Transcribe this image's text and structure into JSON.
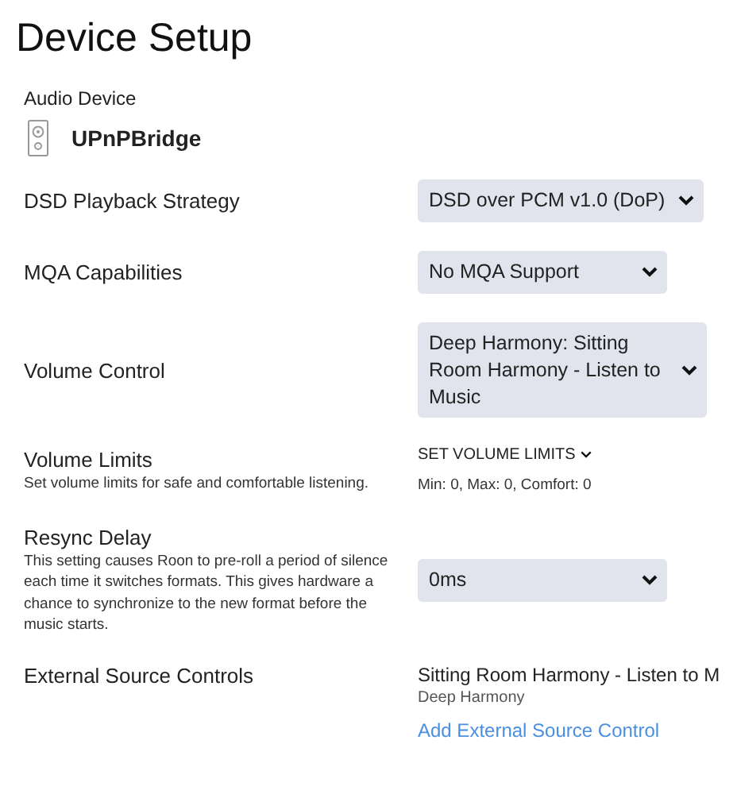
{
  "title": "Device Setup",
  "device": {
    "label": "Audio Device",
    "name": "UPnPBridge"
  },
  "settings": [
    {
      "kind": "select",
      "label": "DSD Playback Strategy",
      "value": "DSD over PCM v1.0 (DoP)"
    },
    {
      "kind": "select",
      "label": "MQA Capabilities",
      "value": "No MQA Support"
    },
    {
      "kind": "select",
      "label": "Volume Control",
      "value": "Deep Harmony: Sitting Room Harmony - Listen to Music"
    },
    {
      "kind": "limits",
      "label": "Volume Limits",
      "description": "Set volume limits for safe and comfortable listening.",
      "action": "SET VOLUME LIMITS",
      "summary": "Min: 0, Max: 0, Comfort: 0"
    },
    {
      "kind": "select",
      "label": "Resync Delay",
      "description": "This setting causes Roon to pre-roll a period of silence each time it switches formats. This gives hardware a chance to synchronize to the new format before the music starts.",
      "value": "0ms"
    },
    {
      "kind": "external",
      "label": "External Source Controls",
      "source": "Sitting Room Harmony - Listen to M",
      "source_owner": "Deep Harmony",
      "action": "Add External Source Control"
    }
  ]
}
